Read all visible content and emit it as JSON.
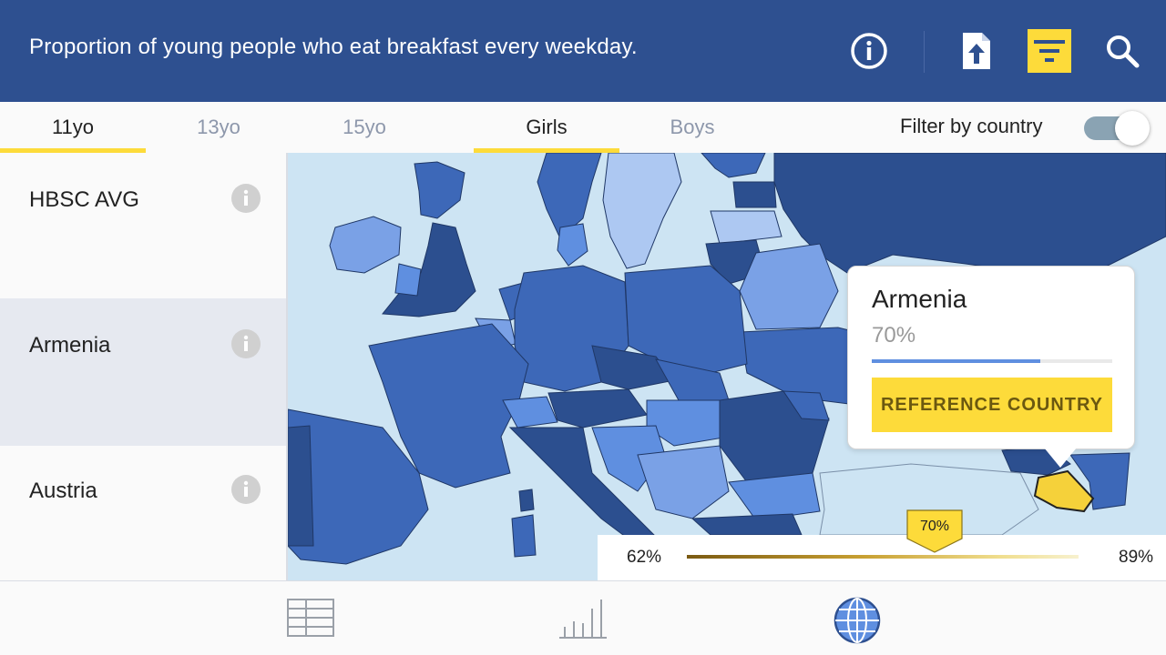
{
  "header": {
    "title": "Proportion of young people who eat breakfast every weekday.",
    "icons": [
      "info-icon",
      "share-upload-icon",
      "filter-icon",
      "search-icon"
    ]
  },
  "age_tabs": [
    {
      "label": "11yo",
      "active": true
    },
    {
      "label": "13yo",
      "active": false
    },
    {
      "label": "15yo",
      "active": false
    }
  ],
  "gender_tabs": [
    {
      "label": "Girls",
      "active": true
    },
    {
      "label": "Boys",
      "active": false
    }
  ],
  "filter": {
    "label": "Filter by country",
    "enabled": true
  },
  "sidebar": {
    "items": [
      {
        "label": "HBSC AVG",
        "selected": false
      },
      {
        "label": "Armenia",
        "selected": true
      },
      {
        "label": "Austria",
        "selected": false
      }
    ]
  },
  "tooltip": {
    "country": "Armenia",
    "value": "70%",
    "value_fraction": 0.7,
    "button_label": "REFERENCE COUNTRY"
  },
  "legend": {
    "min": "62%",
    "max": "89%",
    "marker": "70%"
  },
  "bottom_nav": [
    "table-view-icon",
    "bar-chart-view-icon",
    "globe-map-view-icon"
  ],
  "colors": {
    "header": "#2e5090",
    "accent": "#fddb3a",
    "sea": "#cde4f3",
    "highlight_country": "#f5d13a"
  }
}
